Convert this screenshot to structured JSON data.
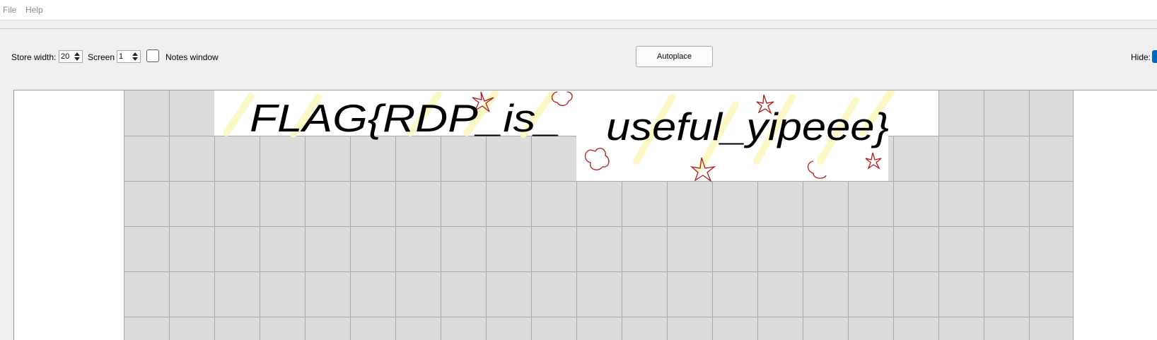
{
  "menu": {
    "file": "File",
    "help": "Help"
  },
  "toolbar": {
    "store_width_label": "Store width:",
    "store_width_value": "20",
    "screen_label": "Screen",
    "screen_value": "1",
    "notes_window_label": "Notes window",
    "notes_window_checked": false,
    "autoplace_label": "Autoplace",
    "hide_label": "Hide:"
  },
  "store": {
    "cell_fill": "#dcdcdc",
    "grid_line": "#a8a8a8",
    "tiles": [
      {
        "text": "FLAG{RDP_is_"
      },
      {
        "text": "useful_yipeee}"
      }
    ]
  },
  "colors": {
    "accent": "#0067c0",
    "doodle_red": "#b01818",
    "highlighter": "#fbf8c4"
  }
}
